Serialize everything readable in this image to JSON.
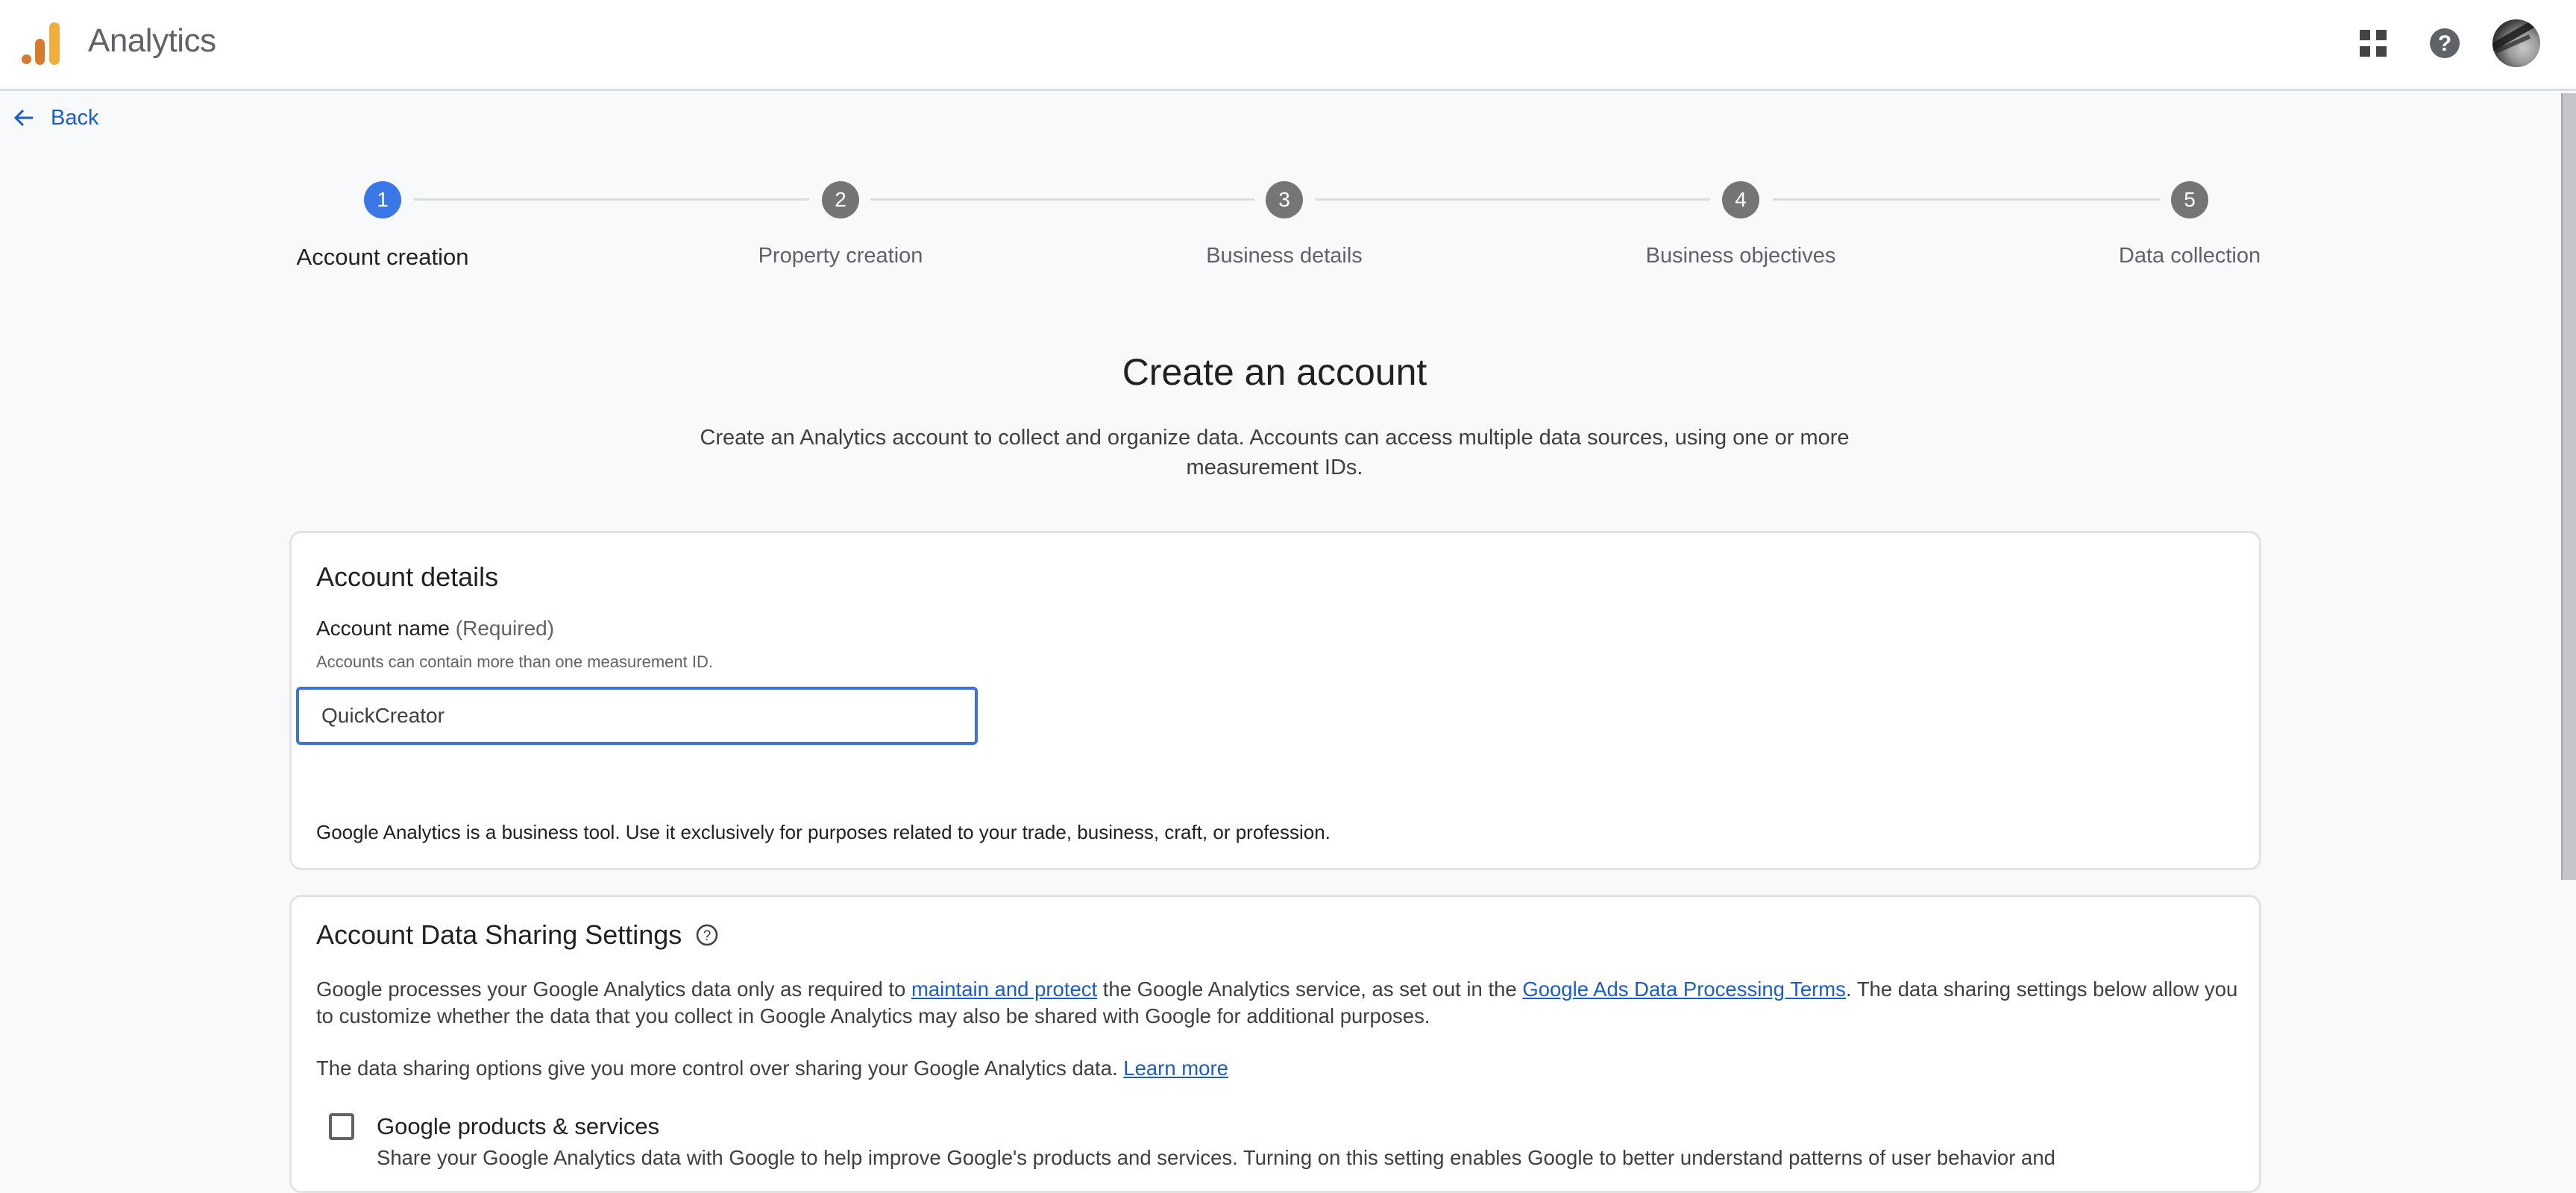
{
  "header": {
    "app_title": "Analytics",
    "logo_colors": {
      "dark": "#D97B2F",
      "light": "#F0AE3C"
    },
    "icons": [
      "apps-grid-icon",
      "help-icon",
      "avatar"
    ]
  },
  "nav": {
    "back_label": "Back"
  },
  "stepper": {
    "steps": [
      {
        "number": "1",
        "label": "Account creation",
        "active": true
      },
      {
        "number": "2",
        "label": "Property creation",
        "active": false
      },
      {
        "number": "3",
        "label": "Business details",
        "active": false
      },
      {
        "number": "4",
        "label": "Business objectives",
        "active": false
      },
      {
        "number": "5",
        "label": "Data collection",
        "active": false
      }
    ],
    "active_color": "#3B78E7",
    "inactive_color": "#757575"
  },
  "page": {
    "title": "Create an account",
    "subtitle": "Create an Analytics account to collect and organize data. Accounts can access multiple data sources, using one or more measurement IDs."
  },
  "account_details": {
    "heading": "Account details",
    "field_label": "Account name",
    "field_required": "(Required)",
    "field_help": "Accounts can contain more than one measurement ID.",
    "account_name_value": "QuickCreator",
    "business_note": "Google Analytics is a business tool. Use it exclusively for purposes related to your trade, business, craft, or profession."
  },
  "data_sharing": {
    "heading": "Account Data Sharing Settings",
    "para1_part1": "Google processes your Google Analytics data only as required to ",
    "para1_link1": "maintain and protect",
    "para1_part2": " the Google Analytics service, as set out in the ",
    "para1_link2": "Google Ads Data Processing Terms",
    "para1_part3": ". The data sharing settings below allow you to customize whether the data that you collect in Google Analytics may also be shared with Google for additional purposes.",
    "para2_text": "The data sharing options give you more control over sharing your Google Analytics data. ",
    "para2_link": "Learn more",
    "options": [
      {
        "label": "Google products & services",
        "checked": false,
        "description": "Share your Google Analytics data with Google to help improve Google's products and services. Turning on this setting enables Google to better understand patterns of user behavior and"
      }
    ]
  },
  "colors": {
    "link": "#1A5DC8",
    "input_focus_border": "#3B74D9",
    "page_background": "#F8F9FA"
  }
}
